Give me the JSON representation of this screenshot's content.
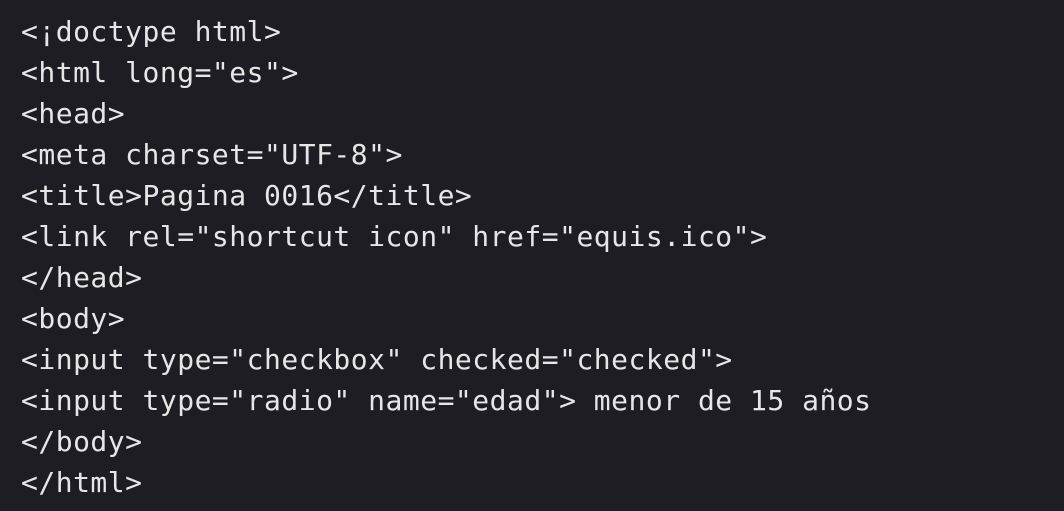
{
  "editor": {
    "lines": [
      "<¡doctype html>",
      "<html long=\"es\">",
      "<head>",
      "<meta charset=\"UTF-8\">",
      "<title>Pagina 0016</title>",
      "<link rel=\"shortcut icon\" href=\"equis.ico\">",
      "</head>",
      "<body>",
      "<input type=\"checkbox\" checked=\"checked\">",
      "<input type=\"radio\" name=\"edad\"> menor de 15 años",
      "</body>",
      "</html>"
    ]
  },
  "colors": {
    "background": "#1e1d24",
    "text": "#e6e6e6"
  }
}
